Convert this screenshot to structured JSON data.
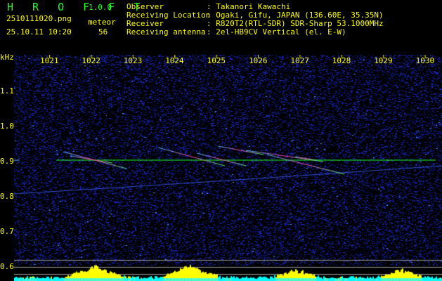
{
  "app": {
    "name": "H R O F F T",
    "version": "1.0.0"
  },
  "file": {
    "name": "2510111020.png",
    "datetime": "25.10.11 10:20"
  },
  "meteor": {
    "label": "meteor",
    "count": "56"
  },
  "info": [
    {
      "label": "Observer",
      "value": ": Takanori Kawachi"
    },
    {
      "label": "Receiving Location",
      "value": ": Ogaki, Gifu, JAPAN (136.60E, 35.35N)"
    },
    {
      "label": "Receiver",
      "value": ": R820T2(RTL-SDR) SDR-Sharp 53.1000MHz"
    },
    {
      "label": "Receiving antenna",
      "value": ": 2el-HB9CV Vertical (el. E-W)"
    }
  ],
  "axis": {
    "unit": "kHz",
    "x_ticks": [
      "1021",
      "1022",
      "1023",
      "1024",
      "1025",
      "1026",
      "1027",
      "1028",
      "1029",
      "1030"
    ],
    "y_ticks": [
      "1.1",
      "1.0",
      "0.9",
      "0.8",
      "0.7",
      "0.6"
    ]
  },
  "colors": {
    "title": "#22ee22",
    "text": "#ffff00",
    "background": "#000000",
    "signal": "#22ff22"
  }
}
